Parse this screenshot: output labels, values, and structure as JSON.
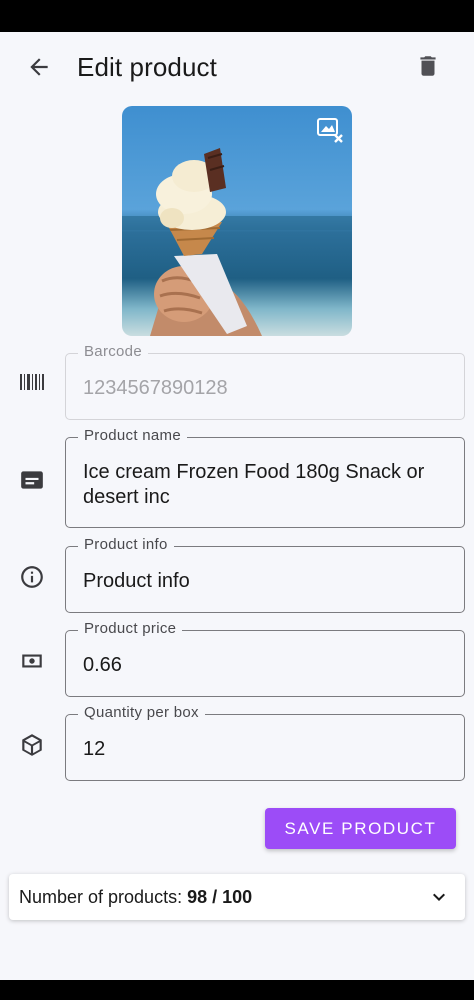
{
  "app": {
    "title": "Edit product"
  },
  "icons": {
    "back": "arrow-left-icon",
    "delete": "trash-icon",
    "remove_image": "image-remove-icon",
    "barcode": "barcode-icon",
    "name": "card-text-icon",
    "info": "info-icon",
    "price": "cash-icon",
    "quantity": "package-icon",
    "expand": "chevron-down-icon"
  },
  "product_image": {
    "description_icon": "ice-cream-photo"
  },
  "fields": {
    "barcode": {
      "label": "Barcode",
      "value": "1234567890128"
    },
    "name": {
      "label": "Product name",
      "value": "Ice cream Frozen Food 180g Snack or desert inc"
    },
    "info": {
      "label": "Product info",
      "value": "Product info"
    },
    "price": {
      "label": "Product price",
      "value": "0.66"
    },
    "quantity": {
      "label": "Quantity per box",
      "value": "12"
    }
  },
  "actions": {
    "save_label": "Save product"
  },
  "product_count": {
    "label": "Number of products:",
    "value": "98 / 100"
  },
  "colors": {
    "accent": "#9c4cf7",
    "background": "#f6f7fb"
  }
}
